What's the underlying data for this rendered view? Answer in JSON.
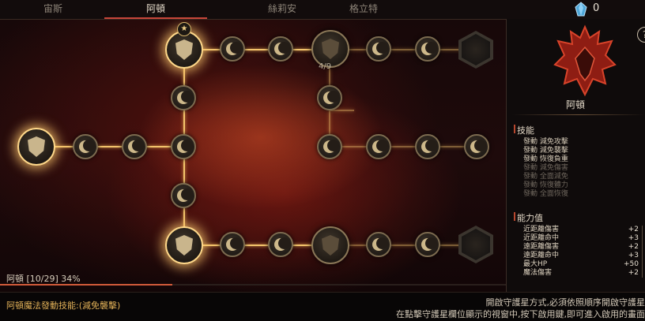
{
  "tabs": [
    {
      "label": "宙斯"
    },
    {
      "label": "阿頓"
    },
    {
      "label": "絲莉安"
    },
    {
      "label": "格立特"
    }
  ],
  "currency": {
    "icon": "blue-gem-icon",
    "count": "0"
  },
  "tree": {
    "star_icon": "star-icon",
    "node_counter": "4/9"
  },
  "panel": {
    "emblem_icon": "red-demon-crest-icon",
    "name": "阿頓",
    "help": "?",
    "skills_title": "技能",
    "skills": [
      {
        "text": "發動 減免攻擊",
        "active": true
      },
      {
        "text": "發動 減免襲擊",
        "active": true
      },
      {
        "text": "發動 恢復負重",
        "active": true
      },
      {
        "text": "發動 減免傷害",
        "active": false
      },
      {
        "text": "發動 全面減免",
        "active": false
      },
      {
        "text": "發動 恢復體力",
        "active": false
      },
      {
        "text": "發動 全面恢復",
        "active": false
      }
    ],
    "stats_title": "能力值",
    "stats": [
      {
        "label": "近距離傷害",
        "value": "+2"
      },
      {
        "label": "近距離命中",
        "value": "+3"
      },
      {
        "label": "遠距離傷害",
        "value": "+2"
      },
      {
        "label": "遠距離命中",
        "value": "+3"
      },
      {
        "label": "最大HP",
        "value": "+50"
      },
      {
        "label": "魔法傷害",
        "value": "+2"
      }
    ]
  },
  "progress": {
    "label": "阿頓 [10/29] 34%",
    "fraction": 0.34
  },
  "footer": {
    "skill_name": "阿頓魔法發動技能:(減免襲擊)",
    "hint_line1": "開啟守護星方式,必須依照順序開啟守護星",
    "hint_line2": "在點擊守護星欄位顯示的視窗中,按下啟用鍵,即可進入啟用的畫面"
  },
  "colors": {
    "accent": "#c8463a",
    "gold": "#f3c46c",
    "skill_active": "#d7ccb9",
    "skill_inactive": "#6e665c"
  }
}
